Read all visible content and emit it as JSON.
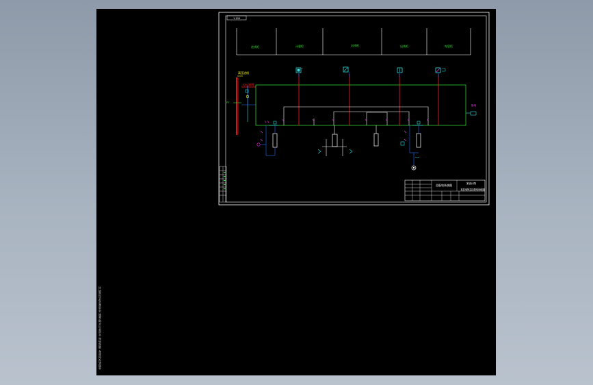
{
  "title_block": {
    "tag_top_left": "1:100",
    "panels": [
      "进线柜",
      "计量柜",
      "出线柜",
      "出线柜",
      "电容柜"
    ],
    "drawing_name": "总配电系统图",
    "subtitle": "某变电所高压配电系统图",
    "company": "某设计院"
  },
  "side_labels": {
    "incoming": "高压进线",
    "busbar": "10kV母线",
    "left_mark": "PT",
    "right_mark": "接地"
  },
  "bottom_note": "本图纸仅供参考 版权所有 未经许可不得复制 技术要求详见说明书",
  "colors": {
    "viewport": "#000000",
    "frame": "#ffffff",
    "bus_green": "#33cc33",
    "feeder_red": "#ff2020",
    "ctrl_blue": "#2a6cff",
    "cyan": "#33dddd",
    "magenta": "#ff33ff",
    "yellow": "#ffff33"
  }
}
